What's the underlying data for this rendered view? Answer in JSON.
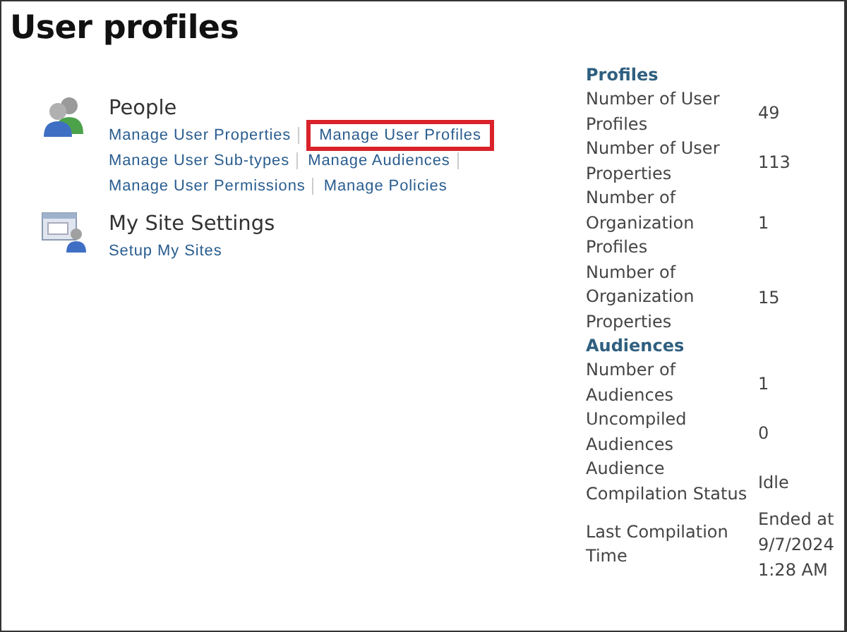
{
  "title": "User profiles",
  "sections": [
    {
      "kind": "people",
      "heading": "People",
      "link_rows": [
        [
          {
            "label": "Manage User Properties",
            "separator": true,
            "highlighted": false
          },
          {
            "label": "Manage User Profiles",
            "separator": false,
            "highlighted": true
          }
        ],
        [
          {
            "label": "Manage User Sub-types",
            "separator": true,
            "highlighted": false
          },
          {
            "label": "Manage Audiences",
            "separator": true,
            "highlighted": false
          }
        ],
        [
          {
            "label": "Manage User Permissions",
            "separator": true,
            "highlighted": false
          },
          {
            "label": "Manage Policies",
            "separator": false,
            "highlighted": false
          }
        ]
      ]
    },
    {
      "kind": "site",
      "heading": "My Site Settings",
      "link_rows": [
        [
          {
            "label": "Setup My Sites",
            "separator": false,
            "highlighted": false
          }
        ]
      ]
    }
  ],
  "stats": [
    {
      "heading": "Profiles",
      "rows": [
        {
          "label": "Number of User Profiles",
          "value": "49"
        },
        {
          "label": "Number of User Properties",
          "value": "113"
        },
        {
          "label": "Number of Organization Profiles",
          "value": "1"
        },
        {
          "label": "Number of Organization Properties",
          "value": "15"
        }
      ]
    },
    {
      "heading": "Audiences",
      "rows": [
        {
          "label": "Number of Audiences",
          "value": "1"
        },
        {
          "label": "Uncompiled Audiences",
          "value": "0"
        },
        {
          "label": "Audience Compilation Status",
          "value": "Idle"
        },
        {
          "label": "Last Compilation Time",
          "value": "Ended at 9/7/2024 1:28 AM"
        }
      ]
    }
  ]
}
